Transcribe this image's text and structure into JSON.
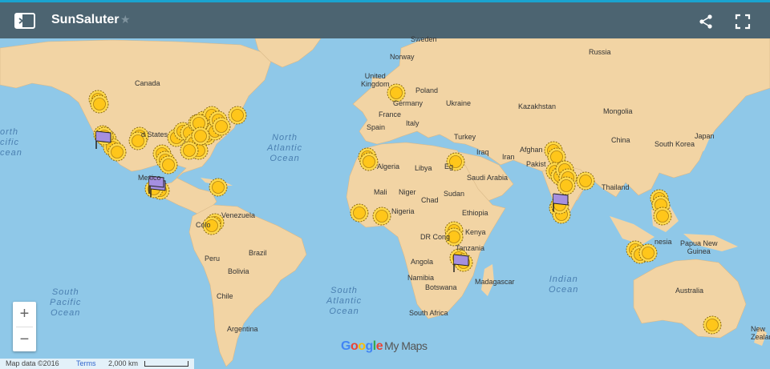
{
  "app": {
    "title": "SunSaluter",
    "colors": {
      "header": "#4c6471",
      "accent": "#1aa3cf",
      "ocean": "#8fc8e8",
      "land": "#f2d4a4",
      "marker": "#ffc61a",
      "flag": "#a58fe0"
    }
  },
  "header": {
    "title": "SunSaluter",
    "icons": [
      "side-panel-icon",
      "star-icon",
      "share-icon",
      "fullscreen-icon"
    ]
  },
  "map": {
    "countries": [
      "Sweden",
      "Norway",
      "United Kingdom",
      "Poland",
      "Germany",
      "Ukraine",
      "Russia",
      "France",
      "Italy",
      "Kazakhstan",
      "Mongolia",
      "Spain",
      "Turkey",
      "China",
      "South Korea",
      "Japan",
      "Iraq",
      "Iran",
      "Afghanistan",
      "Pakistan",
      "Egypt",
      "Algeria",
      "Libya",
      "Saudi Arabia",
      "Thailand",
      "Mali",
      "Niger",
      "Chad",
      "Sudan",
      "Nigeria",
      "Ethiopia",
      "Kenya",
      "DR Congo",
      "Tanzania",
      "Angola",
      "Namibia",
      "Botswana",
      "Madagascar",
      "South Africa",
      "Canada",
      "United States",
      "Mexico",
      "Venezuela",
      "Colombia",
      "Peru",
      "Brazil",
      "Bolivia",
      "Chile",
      "Argentina",
      "Indonesia",
      "Papua New Guinea",
      "Australia",
      "Zealand"
    ],
    "country_labels_partial": [
      "Canada",
      "d States",
      "Mexico",
      "Venezuela",
      "Colo",
      "Peru",
      "Brazil",
      "Bolivia",
      "Chile",
      "Argentina",
      "Norway",
      "Sweden",
      "United\nKingdom",
      "Poland",
      "Germany",
      "Ukraine",
      "Russia",
      "France",
      "Italy",
      "Kazakhstan",
      "Mongolia",
      "Spain",
      "Turkey",
      "China",
      "South Korea",
      "Japan",
      "Iraq",
      "Iran",
      "Afghan",
      "Pakist",
      "Eg",
      "Algeria",
      "Libya",
      "Saudi Arabia",
      "Thailand",
      "Mali",
      "Niger",
      "Chad",
      "Sudan",
      "Nigeria",
      "Ethiopia",
      "Kenya",
      "DR Cong",
      "Tanzania",
      "Angola",
      "Namibia",
      "Botswana",
      "Madagascar",
      "South Africa",
      "Papua New\nGuinea",
      "Australia",
      "New\nZealand",
      "nesia"
    ],
    "oceans": [
      {
        "name": "North\nAtlantic\nOcean"
      },
      {
        "name": "South\nAtlantic\nOcean"
      },
      {
        "name": "South\nPacific\nOcean"
      },
      {
        "name": "Indian\nOcean"
      },
      {
        "name": "orth\ncific\ncean"
      }
    ],
    "markers": {
      "sun_count": 62,
      "flag_count": 5
    },
    "zoom": {
      "in_label": "+",
      "out_label": "−"
    },
    "branding": {
      "google": "Google",
      "my_maps": "My Maps"
    },
    "footer": {
      "map_data": "Map data ©2016",
      "terms": "Terms",
      "scale": "2,000 km"
    }
  }
}
